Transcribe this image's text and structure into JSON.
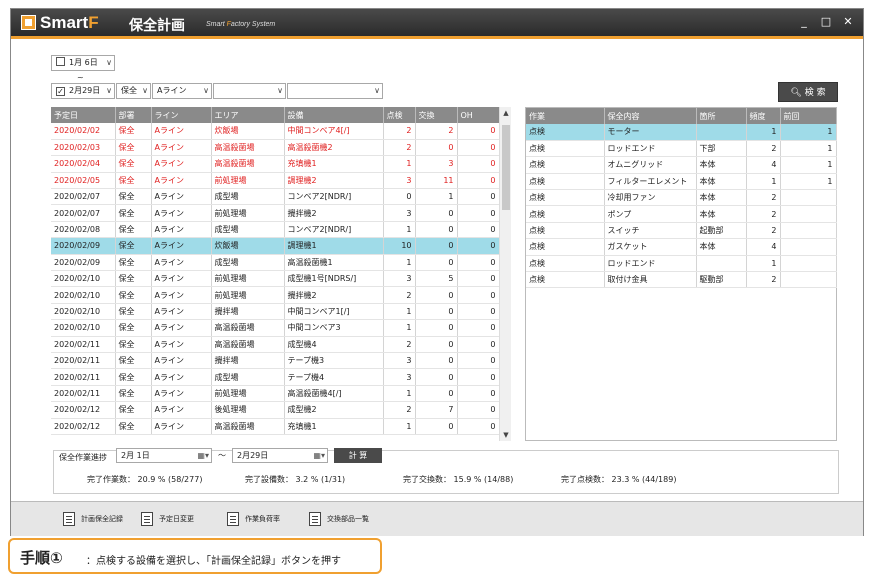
{
  "window": {
    "logo_main": "Smart",
    "logo_f": "F",
    "title": "保全計画",
    "subtitle_a": "Smart ",
    "subtitle_f": "F",
    "subtitle_b": "actory System",
    "minimize": "_",
    "maximize": "□",
    "close": "✕"
  },
  "filters": {
    "date_from": "1月  6日",
    "date_from_checked": false,
    "tilde": "~",
    "date_to": "2月29日",
    "date_to_checked": true,
    "department": "保全",
    "line": "Aライン",
    "area": "",
    "equipment": "",
    "search_label": "検 索"
  },
  "main_table": {
    "headers": [
      "予定日",
      "部署",
      "ライン",
      "エリア",
      "設備",
      "点検",
      "交換",
      "OH"
    ],
    "rows": [
      {
        "date": "2020/02/02",
        "dept": "保全",
        "line": "Aライン",
        "area": "炊飯場",
        "equip": "中間コンベア4[/]",
        "insp": "2",
        "repl": "2",
        "oh": "0",
        "style": "red"
      },
      {
        "date": "2020/02/03",
        "dept": "保全",
        "line": "Aライン",
        "area": "高温殺菌場",
        "equip": "高温殺菌機2",
        "insp": "2",
        "repl": "0",
        "oh": "0",
        "style": "red"
      },
      {
        "date": "2020/02/04",
        "dept": "保全",
        "line": "Aライン",
        "area": "高温殺菌場",
        "equip": "充填機1",
        "insp": "1",
        "repl": "3",
        "oh": "0",
        "style": "red"
      },
      {
        "date": "2020/02/05",
        "dept": "保全",
        "line": "Aライン",
        "area": "前処理場",
        "equip": "調理機2",
        "insp": "3",
        "repl": "11",
        "oh": "0",
        "style": "red"
      },
      {
        "date": "2020/02/07",
        "dept": "保全",
        "line": "Aライン",
        "area": "成型場",
        "equip": "コンベア2[NDR/]",
        "insp": "0",
        "repl": "1",
        "oh": "0",
        "style": ""
      },
      {
        "date": "2020/02/07",
        "dept": "保全",
        "line": "Aライン",
        "area": "前処理場",
        "equip": "攪拌機2",
        "insp": "3",
        "repl": "0",
        "oh": "0",
        "style": ""
      },
      {
        "date": "2020/02/08",
        "dept": "保全",
        "line": "Aライン",
        "area": "成型場",
        "equip": "コンベア2[NDR/]",
        "insp": "1",
        "repl": "0",
        "oh": "0",
        "style": ""
      },
      {
        "date": "2020/02/09",
        "dept": "保全",
        "line": "Aライン",
        "area": "炊飯場",
        "equip": "調理機1",
        "insp": "10",
        "repl": "0",
        "oh": "0",
        "style": "sel"
      },
      {
        "date": "2020/02/09",
        "dept": "保全",
        "line": "Aライン",
        "area": "成型場",
        "equip": "高温殺菌機1",
        "insp": "1",
        "repl": "0",
        "oh": "0",
        "style": ""
      },
      {
        "date": "2020/02/10",
        "dept": "保全",
        "line": "Aライン",
        "area": "前処理場",
        "equip": "成型機1号[NDRS/]",
        "insp": "3",
        "repl": "5",
        "oh": "0",
        "style": ""
      },
      {
        "date": "2020/02/10",
        "dept": "保全",
        "line": "Aライン",
        "area": "前処理場",
        "equip": "攪拌機2",
        "insp": "2",
        "repl": "0",
        "oh": "0",
        "style": ""
      },
      {
        "date": "2020/02/10",
        "dept": "保全",
        "line": "Aライン",
        "area": "攪拌場",
        "equip": "中間コンベア1[/]",
        "insp": "1",
        "repl": "0",
        "oh": "0",
        "style": ""
      },
      {
        "date": "2020/02/10",
        "dept": "保全",
        "line": "Aライン",
        "area": "高温殺菌場",
        "equip": "中間コンベア3",
        "insp": "1",
        "repl": "0",
        "oh": "0",
        "style": ""
      },
      {
        "date": "2020/02/11",
        "dept": "保全",
        "line": "Aライン",
        "area": "高温殺菌場",
        "equip": "成型機4",
        "insp": "2",
        "repl": "0",
        "oh": "0",
        "style": ""
      },
      {
        "date": "2020/02/11",
        "dept": "保全",
        "line": "Aライン",
        "area": "攪拌場",
        "equip": "テープ機3",
        "insp": "3",
        "repl": "0",
        "oh": "0",
        "style": ""
      },
      {
        "date": "2020/02/11",
        "dept": "保全",
        "line": "Aライン",
        "area": "成型場",
        "equip": "テープ機4",
        "insp": "3",
        "repl": "0",
        "oh": "0",
        "style": ""
      },
      {
        "date": "2020/02/11",
        "dept": "保全",
        "line": "Aライン",
        "area": "前処理場",
        "equip": "高温殺菌機4[/]",
        "insp": "1",
        "repl": "0",
        "oh": "0",
        "style": ""
      },
      {
        "date": "2020/02/12",
        "dept": "保全",
        "line": "Aライン",
        "area": "後処理場",
        "equip": "成型機2",
        "insp": "2",
        "repl": "7",
        "oh": "0",
        "style": ""
      },
      {
        "date": "2020/02/12",
        "dept": "保全",
        "line": "Aライン",
        "area": "高温殺菌場",
        "equip": "充填機1",
        "insp": "1",
        "repl": "0",
        "oh": "0",
        "style": ""
      }
    ]
  },
  "detail_table": {
    "headers": [
      "作業",
      "保全内容",
      "箇所",
      "頻度",
      "前回"
    ],
    "rows": [
      {
        "work": "点検",
        "content": "モーター",
        "place": "",
        "freq": "1",
        "prev": "1",
        "style": "sel"
      },
      {
        "work": "点検",
        "content": "ロッドエンド",
        "place": "下部",
        "freq": "2",
        "prev": "1",
        "style": ""
      },
      {
        "work": "点検",
        "content": "オムニグリッド",
        "place": "本体",
        "freq": "4",
        "prev": "1",
        "style": ""
      },
      {
        "work": "点検",
        "content": "フィルターエレメント",
        "place": "本体",
        "freq": "1",
        "prev": "1",
        "style": ""
      },
      {
        "work": "点検",
        "content": "冷却用ファン",
        "place": "本体",
        "freq": "2",
        "prev": "",
        "style": ""
      },
      {
        "work": "点検",
        "content": "ポンプ",
        "place": "本体",
        "freq": "2",
        "prev": "",
        "style": ""
      },
      {
        "work": "点検",
        "content": "スイッチ",
        "place": "起動部",
        "freq": "2",
        "prev": "",
        "style": ""
      },
      {
        "work": "点検",
        "content": "ガスケット",
        "place": "本体",
        "freq": "4",
        "prev": "",
        "style": ""
      },
      {
        "work": "点検",
        "content": "ロッドエンド",
        "place": "",
        "freq": "1",
        "prev": "",
        "style": ""
      },
      {
        "work": "点検",
        "content": "取付け金具",
        "place": "駆動部",
        "freq": "2",
        "prev": "",
        "style": ""
      }
    ]
  },
  "progress": {
    "title": "保全作業進捗",
    "from": "2月  1日",
    "to": "2月29日",
    "tilde": "～",
    "calc_label": "計 算",
    "work_label": "完了作業数：",
    "work_value": "20.9 % (58/277)",
    "equip_label": "完了設備数：",
    "equip_value": "3.2 % (1/31)",
    "repl_label": "完了交換数：",
    "repl_value": "15.9 % (14/88)",
    "insp_label": "完了点検数：",
    "insp_value": "23.3 % (44/189)"
  },
  "toolbar": {
    "record": "計画保全記録",
    "change_date": "予定日変更",
    "workload": "作業負荷率",
    "parts_list": "交換部品一覧"
  },
  "callout": {
    "step": "手順①",
    "text": "：点検する設備を選択し、「計画保全記録」ボタンを押す"
  },
  "colors": {
    "accent": "#f0a030",
    "selected_row": "#9fdbe8",
    "overdue_text": "#e02020",
    "header_bg": "#8a8a8a"
  }
}
